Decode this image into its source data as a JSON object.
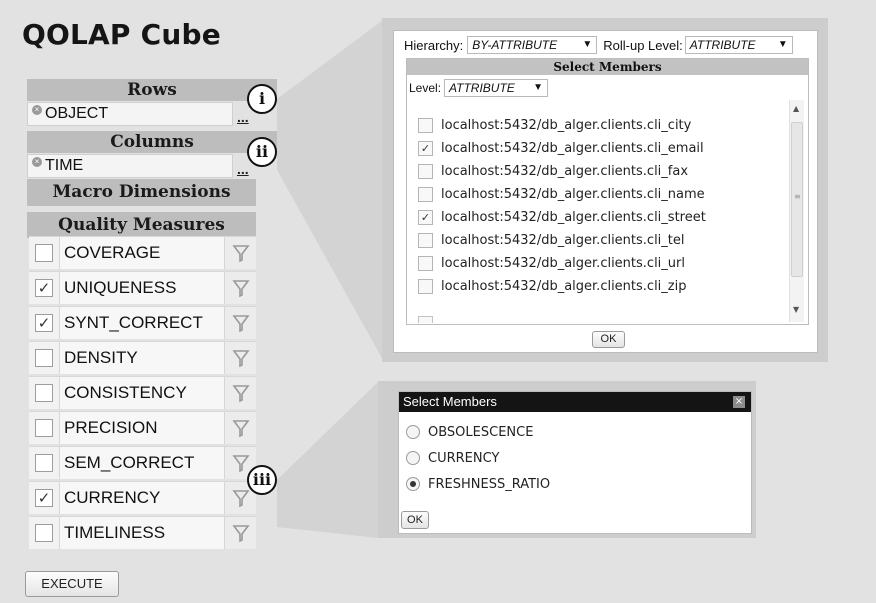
{
  "app": {
    "title": "QOLAP Cube"
  },
  "rows": {
    "header": "Rows",
    "value": "OBJECT",
    "browse_label": "..."
  },
  "columns": {
    "header": "Columns",
    "value": "TIME",
    "browse_label": "..."
  },
  "macro_dimensions": {
    "header": "Macro Dimensions"
  },
  "quality_measures": {
    "header": "Quality Measures",
    "items": [
      {
        "label": "COVERAGE",
        "checked": false,
        "mark": ""
      },
      {
        "label": "UNIQUENESS",
        "checked": true,
        "mark": "✓"
      },
      {
        "label": "SYNT_CORRECT",
        "checked": true,
        "mark": "✓"
      },
      {
        "label": "DENSITY",
        "checked": false,
        "mark": ""
      },
      {
        "label": "CONSISTENCY",
        "checked": false,
        "mark": ""
      },
      {
        "label": "PRECISION",
        "checked": false,
        "mark": ""
      },
      {
        "label": "SEM_CORRECT",
        "checked": false,
        "mark": ""
      },
      {
        "label": "CURRENCY",
        "checked": true,
        "mark": "✓"
      },
      {
        "label": "TIMELINESS",
        "checked": false,
        "mark": ""
      }
    ]
  },
  "execute_button": {
    "label": "EXECUTE"
  },
  "callouts": {
    "one": "i",
    "two": "ii",
    "three": "iii"
  },
  "member_panel": {
    "hierarchy_label": "Hierarchy:",
    "hierarchy_value": "BY-ATTRIBUTE",
    "rollup_label": "Roll-up Level:",
    "rollup_value": "ATTRIBUTE",
    "title": "Select Members",
    "level_label": "Level:",
    "level_value": "ATTRIBUTE",
    "members": [
      {
        "label": "localhost:5432/db_alger.clients.cli_city",
        "mark": ""
      },
      {
        "label": "localhost:5432/db_alger.clients.cli_email",
        "mark": "✓"
      },
      {
        "label": "localhost:5432/db_alger.clients.cli_fax",
        "mark": ""
      },
      {
        "label": "localhost:5432/db_alger.clients.cli_name",
        "mark": ""
      },
      {
        "label": "localhost:5432/db_alger.clients.cli_street",
        "mark": "✓"
      },
      {
        "label": "localhost:5432/db_alger.clients.cli_tel",
        "mark": ""
      },
      {
        "label": "localhost:5432/db_alger.clients.cli_url",
        "mark": ""
      },
      {
        "label": "localhost:5432/db_alger.clients.cli_zip",
        "mark": ""
      }
    ],
    "ok_label": "OK"
  },
  "measure_dialog": {
    "title": "Select Members",
    "close_label": "×",
    "options": [
      {
        "label": "OBSOLESCENCE",
        "selected": false
      },
      {
        "label": "CURRENCY",
        "selected": false
      },
      {
        "label": "FRESHNESS_RATIO",
        "selected": true
      }
    ],
    "ok_label": "OK"
  }
}
